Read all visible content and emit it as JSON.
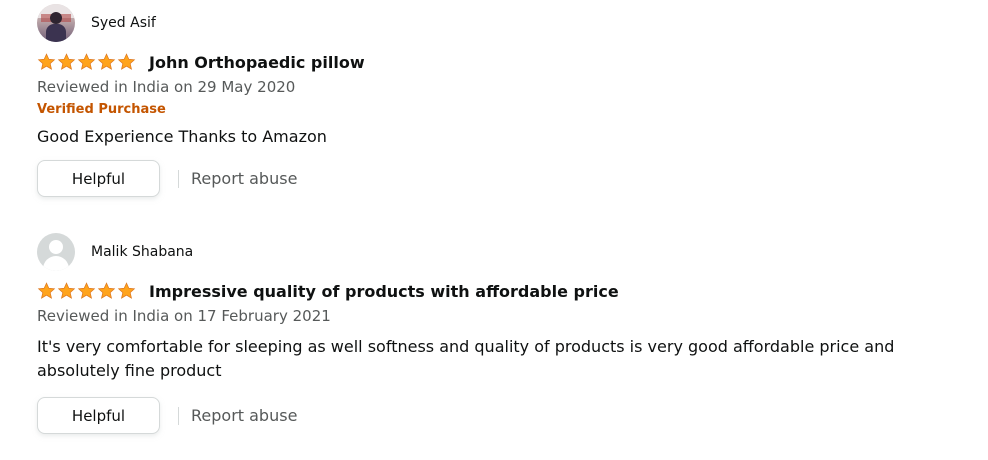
{
  "reviews": [
    {
      "profile_name": "Syed Asif",
      "avatar": "user-photo",
      "rating": 5,
      "rating_max": 5,
      "title": "John Orthopaedic pillow",
      "date": "Reviewed in India on 29 May 2020",
      "verified": "Verified Purchase",
      "body": "Good Experience Thanks to Amazon",
      "helpful_label": "Helpful",
      "report_label": "Report abuse"
    },
    {
      "profile_name": "Malik Shabana",
      "avatar": "default-avatar",
      "rating": 5,
      "rating_max": 5,
      "title": "Impressive quality of products with affordable price",
      "date": "Reviewed in India on 17 February 2021",
      "body": "It's very comfortable for sleeping as well softness and quality of products is very good affordable price and absolutely fine product",
      "helpful_label": "Helpful",
      "report_label": "Report abuse"
    }
  ],
  "colors": {
    "star": "#ffa41c",
    "verified": "#c45500",
    "secondary_text": "#565959"
  },
  "icons": {
    "star": "star-icon"
  }
}
